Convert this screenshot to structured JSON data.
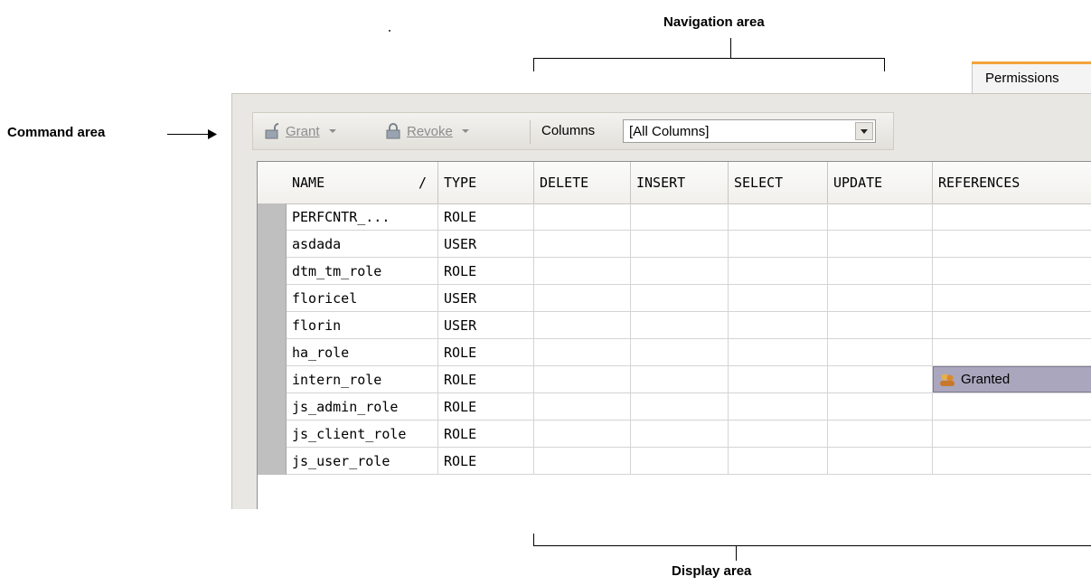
{
  "annotations": {
    "navigation": "Navigation area",
    "command": "Command area",
    "display": "Display area"
  },
  "tab": {
    "label": "Permissions",
    "accent": "#f3a33a"
  },
  "toolbar": {
    "grant_label": "Grant",
    "revoke_label": "Revoke",
    "columns_label": "Columns",
    "columns_value": "[All Columns]"
  },
  "grid": {
    "columns": [
      "NAME",
      "TYPE",
      "DELETE",
      "INSERT",
      "SELECT",
      "UPDATE",
      "REFERENCES"
    ],
    "sort_indicator": "/",
    "rows": [
      {
        "name": "PERFCNTR_...",
        "type": "ROLE",
        "references": ""
      },
      {
        "name": "asdada",
        "type": "USER",
        "references": ""
      },
      {
        "name": "dtm_tm_role",
        "type": "ROLE",
        "references": ""
      },
      {
        "name": "floricel",
        "type": "USER",
        "references": ""
      },
      {
        "name": "florin",
        "type": "USER",
        "references": ""
      },
      {
        "name": "ha_role",
        "type": "ROLE",
        "references": ""
      },
      {
        "name": "intern_role",
        "type": "ROLE",
        "references": "Granted"
      },
      {
        "name": "js_admin_role",
        "type": "ROLE",
        "references": ""
      },
      {
        "name": "js_client_role",
        "type": "ROLE",
        "references": ""
      },
      {
        "name": "js_user_role",
        "type": "ROLE",
        "references": ""
      }
    ]
  },
  "colors": {
    "granted_bg": "#a9a6bd",
    "selector": "#bfbfbf"
  }
}
